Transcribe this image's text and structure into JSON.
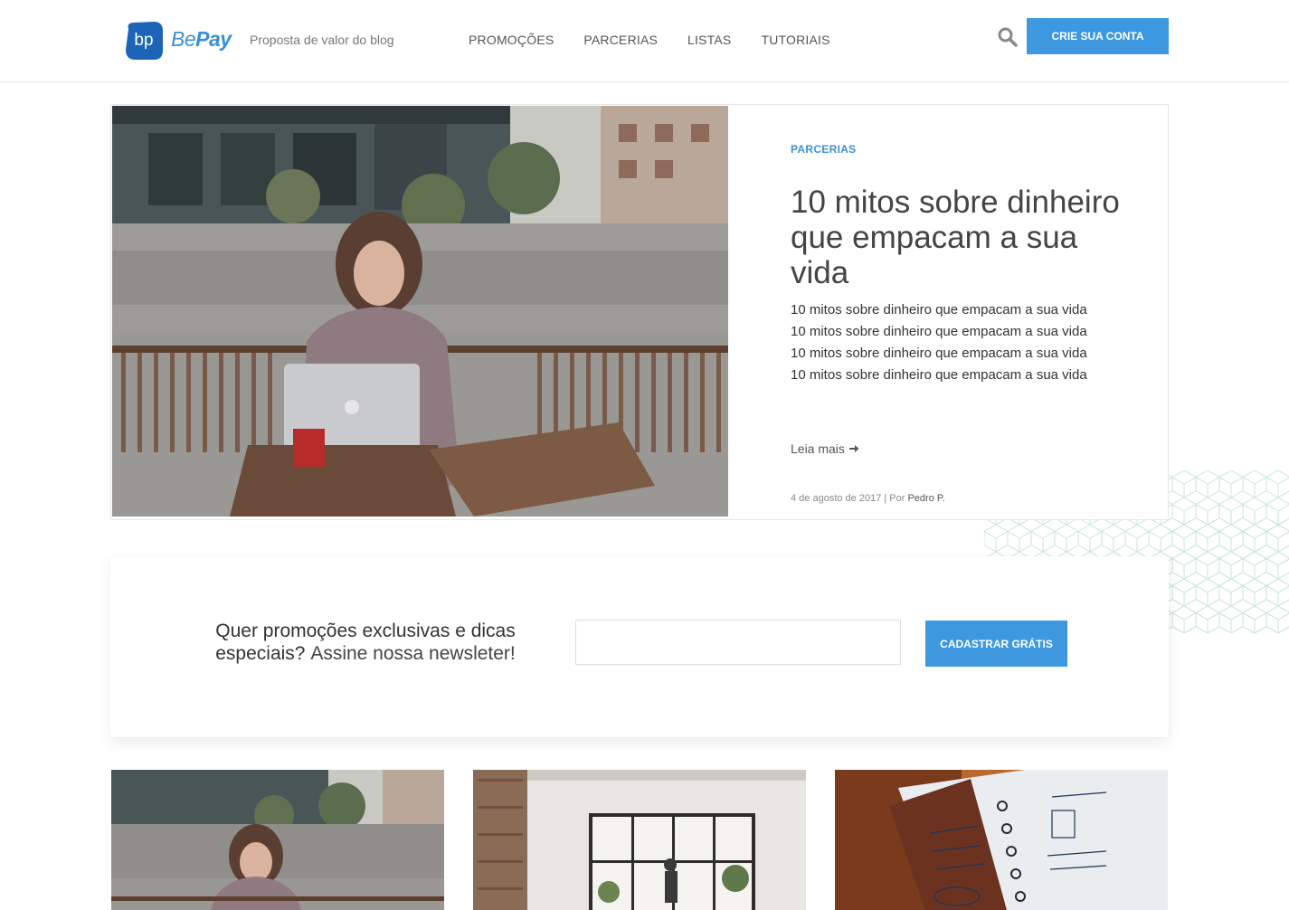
{
  "brand": {
    "logo_mark": "bp",
    "name_part1": "Be",
    "name_part2": "Pay",
    "tagline": "Proposta de valor do blog"
  },
  "nav": {
    "items": [
      {
        "label": "PROMOÇÕES"
      },
      {
        "label": "PARCERIAS"
      },
      {
        "label": "LISTAS"
      },
      {
        "label": "TUTORIAIS"
      }
    ],
    "signup_label": "CRIE SUA CONTA"
  },
  "hero": {
    "category": "PARCERIAS",
    "title": "10 mitos sobre dinheiro que empacam a sua vida",
    "excerpt": "10 mitos sobre dinheiro que empacam a sua vida 10 mitos sobre dinheiro que empacam a sua vida 10 mitos sobre dinheiro que empacam a sua vida 10 mitos sobre dinheiro que empacam a sua vida",
    "read_more": "Leia mais",
    "date": "4 de agosto de 2017 | Por",
    "author": "Pedro P."
  },
  "newsletter": {
    "text_strong": "Quer promoções exclusivas e dicas especiais?",
    "text_light": "Assine nossa newsleter!",
    "input_value": "",
    "button_label": "CADASTRAR GRÁTIS"
  },
  "colors": {
    "accent": "#3d98e0",
    "category": "#3d8fd8",
    "pattern": "#bfe0da"
  }
}
